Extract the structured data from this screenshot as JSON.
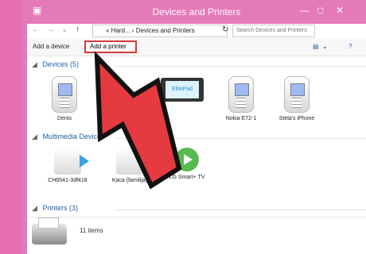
{
  "window": {
    "title": "Devices and Printers",
    "controls": [
      "—",
      "□",
      "✕"
    ]
  },
  "navigation": {
    "back": "←",
    "forward": "→",
    "dropdown": "⌄",
    "up": "↑",
    "breadcrumb": "« Hard... › Devices and Printers",
    "refresh": "↻",
    "search_placeholder": "Search Devices and Printers"
  },
  "toolbar": {
    "add_device": "Add a device",
    "add_printer": "Add a printer",
    "view_icon": "▤",
    "view_dropdown": "⌄",
    "help": "?"
  },
  "sections": [
    {
      "label": "Devices (5)",
      "arrow": "◢"
    },
    {
      "label": "Multimedia Devices",
      "arrow": "◢"
    },
    {
      "label": "Printers (3)",
      "arrow": "◢"
    }
  ],
  "devices": [
    {
      "label": "Denis"
    },
    {
      "label": ""
    },
    {
      "label": "Nokia E72-1"
    },
    {
      "label": "Stela's iPhone"
    }
  ],
  "tablet_brand": "ElitePad",
  "multimedia": [
    {
      "label": "CH6541-3df418"
    },
    {
      "label": "Kaca (familija)"
    },
    {
      "label": "LG Smart+ TV"
    }
  ],
  "status": {
    "items": "11 items"
  },
  "accent_color": "#e57ab9"
}
